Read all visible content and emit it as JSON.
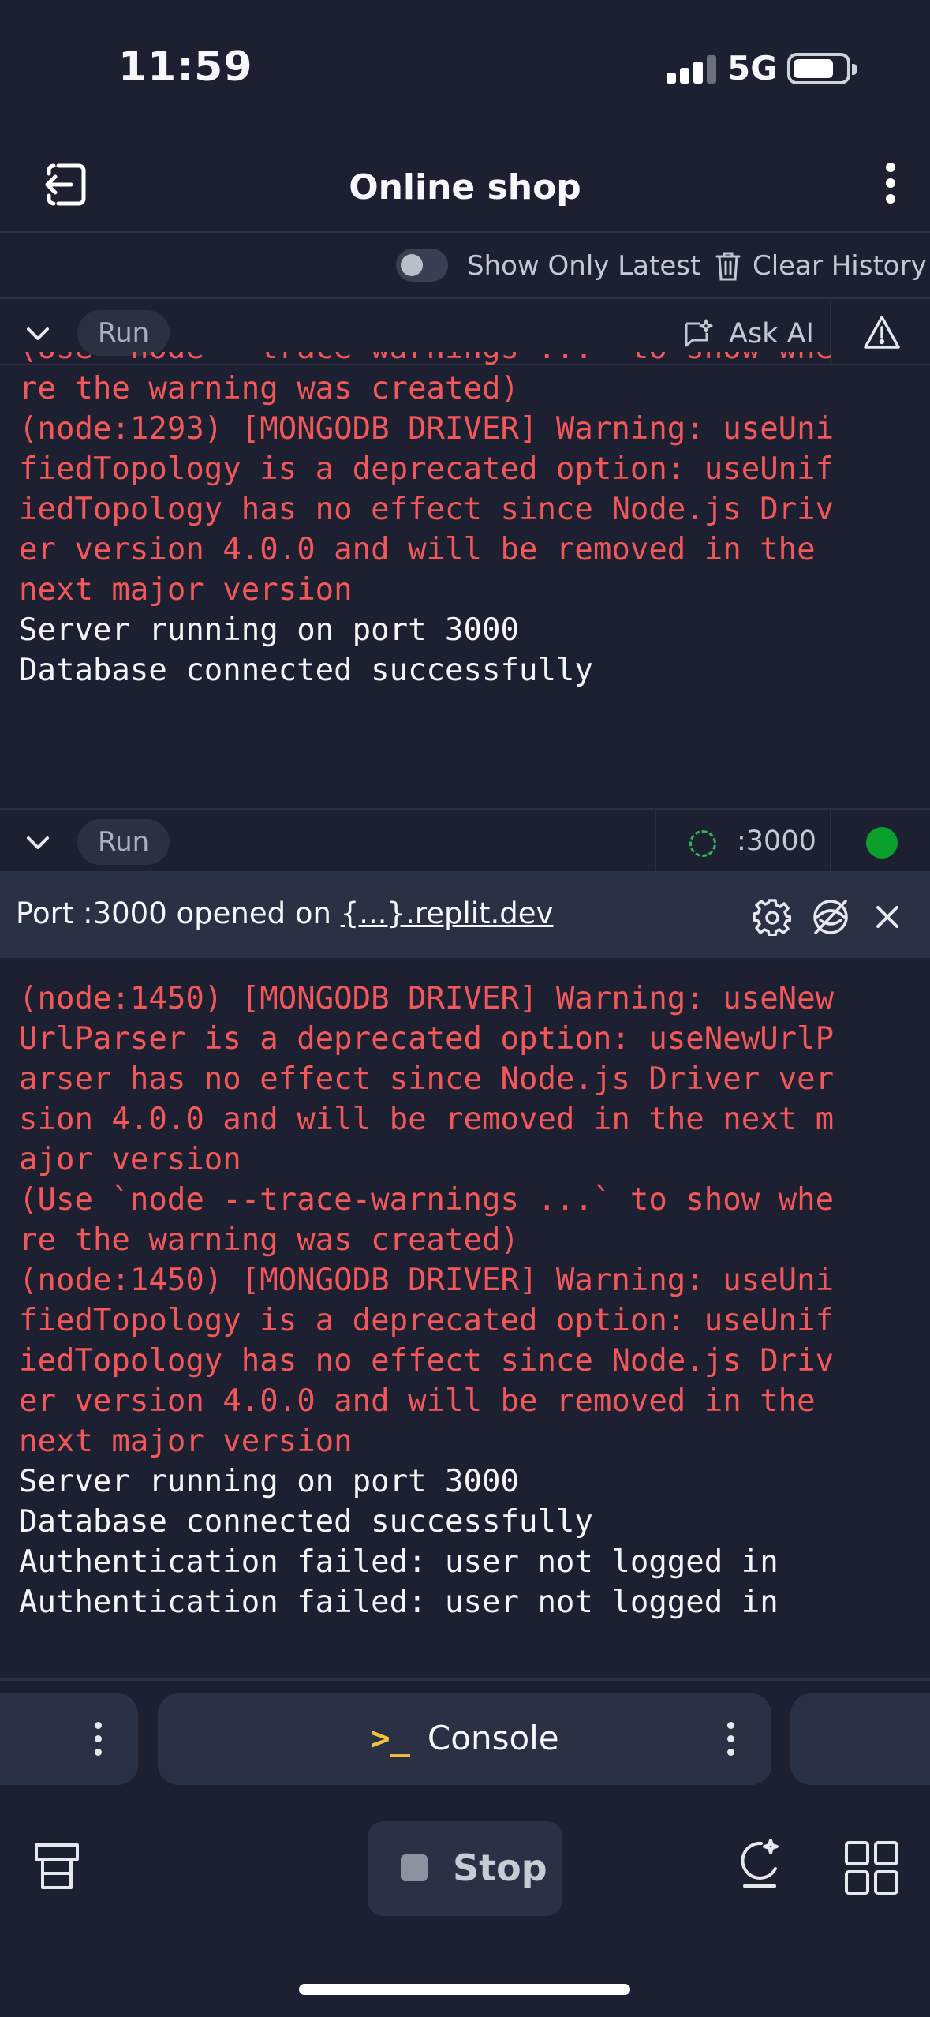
{
  "status": {
    "time": "11:59",
    "network": "5G"
  },
  "header": {
    "title": "Online shop"
  },
  "toolbar": {
    "toggle_label": "Show Only Latest",
    "clear_label": "Clear History"
  },
  "panel1": {
    "run_label": "Run",
    "ask_ai_label": "Ask AI",
    "lines": [
      {
        "text": "(Use `node --trace-warnings ...` to show whe",
        "kind": "err"
      },
      {
        "text": "re the warning was created)",
        "kind": "err"
      },
      {
        "text": "(node:1293) [MONGODB DRIVER] Warning: useUni",
        "kind": "err"
      },
      {
        "text": "fiedTopology is a deprecated option: useUnif",
        "kind": "err"
      },
      {
        "text": "iedTopology has no effect since Node.js Driv",
        "kind": "err"
      },
      {
        "text": "er version 4.0.0 and will be removed in the",
        "kind": "err"
      },
      {
        "text": "next major version",
        "kind": "err"
      },
      {
        "text": "Server running on port 3000",
        "kind": "ok"
      },
      {
        "text": "Database connected successfully",
        "kind": "ok"
      }
    ]
  },
  "panel2": {
    "run_label": "Run",
    "port_label": ":3000",
    "banner_prefix": "Port :3000 opened on ",
    "banner_link": "{...}.replit.dev",
    "lines": [
      {
        "text": "(node:1450) [MONGODB DRIVER] Warning: useNew",
        "kind": "err"
      },
      {
        "text": "UrlParser is a deprecated option: useNewUrlP",
        "kind": "err"
      },
      {
        "text": "arser has no effect since Node.js Driver ver",
        "kind": "err"
      },
      {
        "text": "sion 4.0.0 and will be removed in the next m",
        "kind": "err"
      },
      {
        "text": "ajor version",
        "kind": "err"
      },
      {
        "text": "(Use `node --trace-warnings ...` to show whe",
        "kind": "err"
      },
      {
        "text": "re the warning was created)",
        "kind": "err"
      },
      {
        "text": "(node:1450) [MONGODB DRIVER] Warning: useUni",
        "kind": "err"
      },
      {
        "text": "fiedTopology is a deprecated option: useUnif",
        "kind": "err"
      },
      {
        "text": "iedTopology has no effect since Node.js Driv",
        "kind": "err"
      },
      {
        "text": "er version 4.0.0 and will be removed in the",
        "kind": "err"
      },
      {
        "text": "next major version",
        "kind": "err"
      },
      {
        "text": "Server running on port 3000",
        "kind": "ok"
      },
      {
        "text": "Database connected successfully",
        "kind": "ok"
      },
      {
        "text": "Authentication failed: user not logged in",
        "kind": "ok"
      },
      {
        "text": "Authentication failed: user not logged in",
        "kind": "ok"
      }
    ]
  },
  "tabs": {
    "console_glyph": ">_",
    "console_label": "Console"
  },
  "bottom": {
    "stop_label": "Stop"
  },
  "colors": {
    "error": "#f2575a",
    "running": "#0aa02b",
    "accent": "#f0c23c"
  }
}
